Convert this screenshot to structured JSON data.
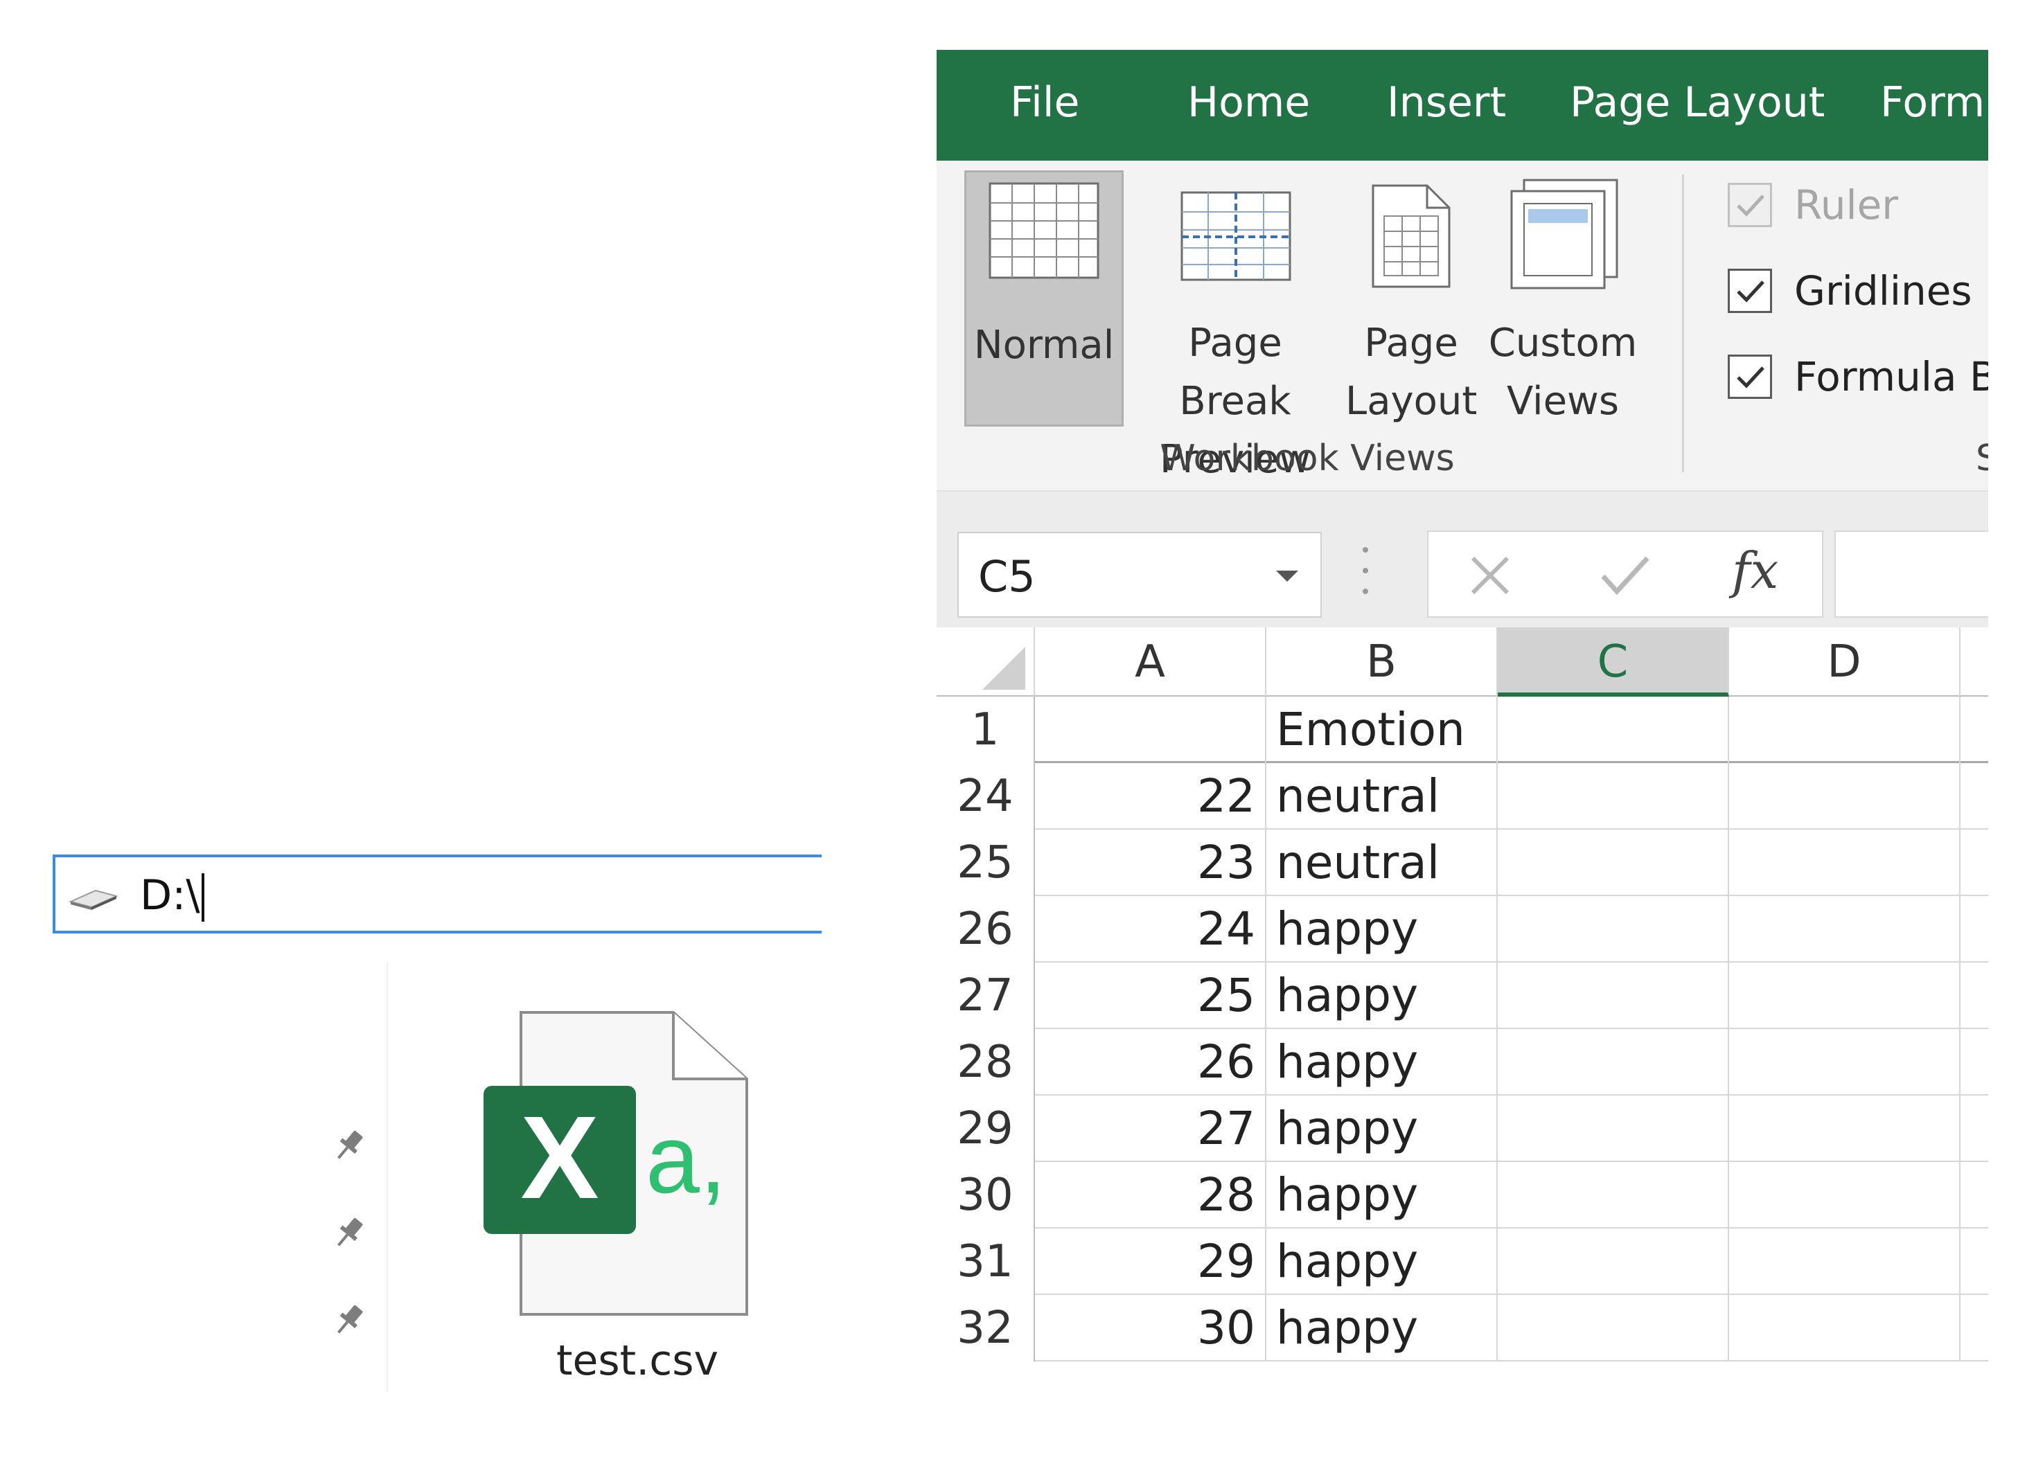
{
  "explorer": {
    "address": "D:\\",
    "file_name": "test.csv",
    "file_icon_letter": "X",
    "file_icon_glyph": "a,"
  },
  "excel": {
    "menu_tabs": [
      "File",
      "Home",
      "Insert",
      "Page Layout",
      "Formu"
    ],
    "ribbon": {
      "views": [
        {
          "line1": "Normal",
          "line2": ""
        },
        {
          "line1": "Page Break",
          "line2": "Preview"
        },
        {
          "line1": "Page",
          "line2": "Layout"
        },
        {
          "line1": "Custom",
          "line2": "Views"
        }
      ],
      "group_label": "Workbook Views",
      "group_label_2": "S",
      "show": [
        {
          "label": "Ruler",
          "checked": true,
          "disabled": true
        },
        {
          "label": "Gridlines",
          "checked": true,
          "disabled": false
        },
        {
          "label": "Formula Ba",
          "checked": true,
          "disabled": false
        }
      ]
    },
    "formula_bar": {
      "name_box": "C5",
      "fx_label": "fx",
      "value": ""
    },
    "columns": [
      "A",
      "B",
      "C",
      "D"
    ],
    "active_column": "C",
    "rows": [
      {
        "num": "1",
        "a": "",
        "b": "Emotion"
      },
      {
        "num": "24",
        "a": "22",
        "b": "neutral"
      },
      {
        "num": "25",
        "a": "23",
        "b": "neutral"
      },
      {
        "num": "26",
        "a": "24",
        "b": "happy"
      },
      {
        "num": "27",
        "a": "25",
        "b": "happy"
      },
      {
        "num": "28",
        "a": "26",
        "b": "happy"
      },
      {
        "num": "29",
        "a": "27",
        "b": "happy"
      },
      {
        "num": "30",
        "a": "28",
        "b": "happy"
      },
      {
        "num": "31",
        "a": "29",
        "b": "happy"
      },
      {
        "num": "32",
        "a": "30",
        "b": "happy"
      }
    ],
    "colors": {
      "excel_green": "#217346",
      "accent_blue": "#3b8ce0"
    }
  }
}
